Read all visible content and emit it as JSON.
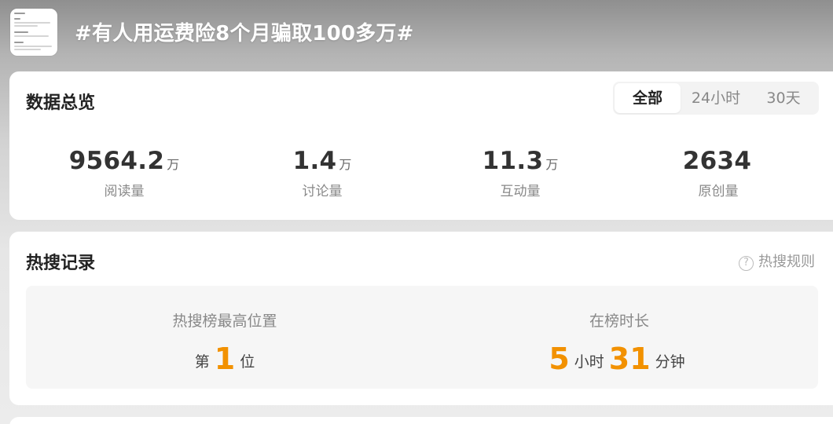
{
  "header": {
    "topic_title": "#有人用运费险8个月骗取100多万#",
    "thumbnail_icon": "topic-cover-thumbnail"
  },
  "overview": {
    "title": "数据总览",
    "tabs": [
      {
        "label": "全部",
        "active": true
      },
      {
        "label": "24小时",
        "active": false
      },
      {
        "label": "30天",
        "active": false
      }
    ],
    "stats": [
      {
        "value": "9564.2",
        "unit": "万",
        "label": "阅读量"
      },
      {
        "value": "1.4",
        "unit": "万",
        "label": "讨论量"
      },
      {
        "value": "11.3",
        "unit": "万",
        "label": "互动量"
      },
      {
        "value": "2634",
        "unit": "",
        "label": "原创量"
      }
    ]
  },
  "hot_search": {
    "title": "热搜记录",
    "rules_link": "热搜规则",
    "rules_icon": "question-circle-icon",
    "peak": {
      "label": "热搜榜最高位置",
      "prefix": "第",
      "value": "1",
      "suffix": "位"
    },
    "duration": {
      "label": "在榜时长",
      "hours": "5",
      "hours_unit": "小时",
      "minutes": "31",
      "minutes_unit": "分钟"
    }
  },
  "colors": {
    "accent": "#f29100",
    "card_bg": "#ffffff",
    "box_bg": "#f6f6f6"
  }
}
